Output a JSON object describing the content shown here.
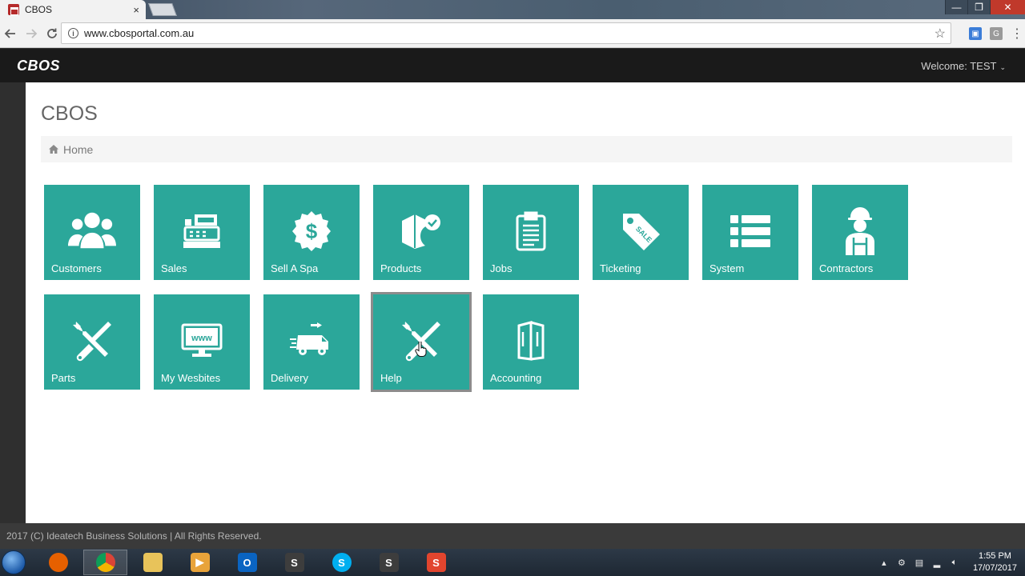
{
  "browser": {
    "tab_title": "CBOS",
    "tab_close": "×",
    "url": "www.cbosportal.com.au",
    "window_controls": {
      "minimize": "—",
      "maximize": "❐",
      "close": "✕"
    },
    "ext_1": "▣",
    "ext_2": "G"
  },
  "header": {
    "brand": "CBOS",
    "welcome": "Welcome: TEST",
    "welcome_chevron": "⌄"
  },
  "page": {
    "title": "CBOS",
    "breadcrumb": "Home"
  },
  "tiles": [
    {
      "label": "Customers",
      "icon": "customers-icon"
    },
    {
      "label": "Sales",
      "icon": "cash-register-icon"
    },
    {
      "label": "Sell A Spa",
      "icon": "dollar-badge-icon"
    },
    {
      "label": "Products",
      "icon": "box-check-icon"
    },
    {
      "label": "Jobs",
      "icon": "clipboard-icon"
    },
    {
      "label": "Ticketing",
      "icon": "sale-tag-icon"
    },
    {
      "label": "System",
      "icon": "list-icon"
    },
    {
      "label": "Contractors",
      "icon": "worker-icon"
    },
    {
      "label": "Parts",
      "icon": "tools-icon"
    },
    {
      "label": "My Wesbites",
      "icon": "monitor-www-icon"
    },
    {
      "label": "Delivery",
      "icon": "delivery-truck-icon"
    },
    {
      "label": "Help",
      "icon": "tools-icon"
    },
    {
      "label": "Accounting",
      "icon": "open-book-icon"
    }
  ],
  "monitor_text": "www",
  "sale_text": "SALE",
  "footer": {
    "text": "2017 (C) Ideatech Business Solutions | All Rights Reserved."
  },
  "taskbar": {
    "apps": [
      {
        "name": "firefox",
        "glyph": "",
        "color": "#e66000"
      },
      {
        "name": "chrome",
        "glyph": "",
        "color": "#4285f4"
      },
      {
        "name": "explorer",
        "glyph": "",
        "color": "#e8c35a"
      },
      {
        "name": "media-player",
        "glyph": "▶",
        "color": "#e8a33a"
      },
      {
        "name": "outlook",
        "glyph": "O",
        "color": "#0a64c2"
      },
      {
        "name": "app-s-1",
        "glyph": "S",
        "color": "#3d3d3d"
      },
      {
        "name": "skype",
        "glyph": "S",
        "color": "#00aff0"
      },
      {
        "name": "app-s-2",
        "glyph": "S",
        "color": "#3d3d3d"
      },
      {
        "name": "snagit",
        "glyph": "S",
        "color": "#e2452e"
      }
    ],
    "time": "1:55 PM",
    "date": "17/07/2017"
  },
  "colors": {
    "tile": "#2ba79a",
    "appbar": "#1a1a1a",
    "footer": "#3a3a3a"
  }
}
